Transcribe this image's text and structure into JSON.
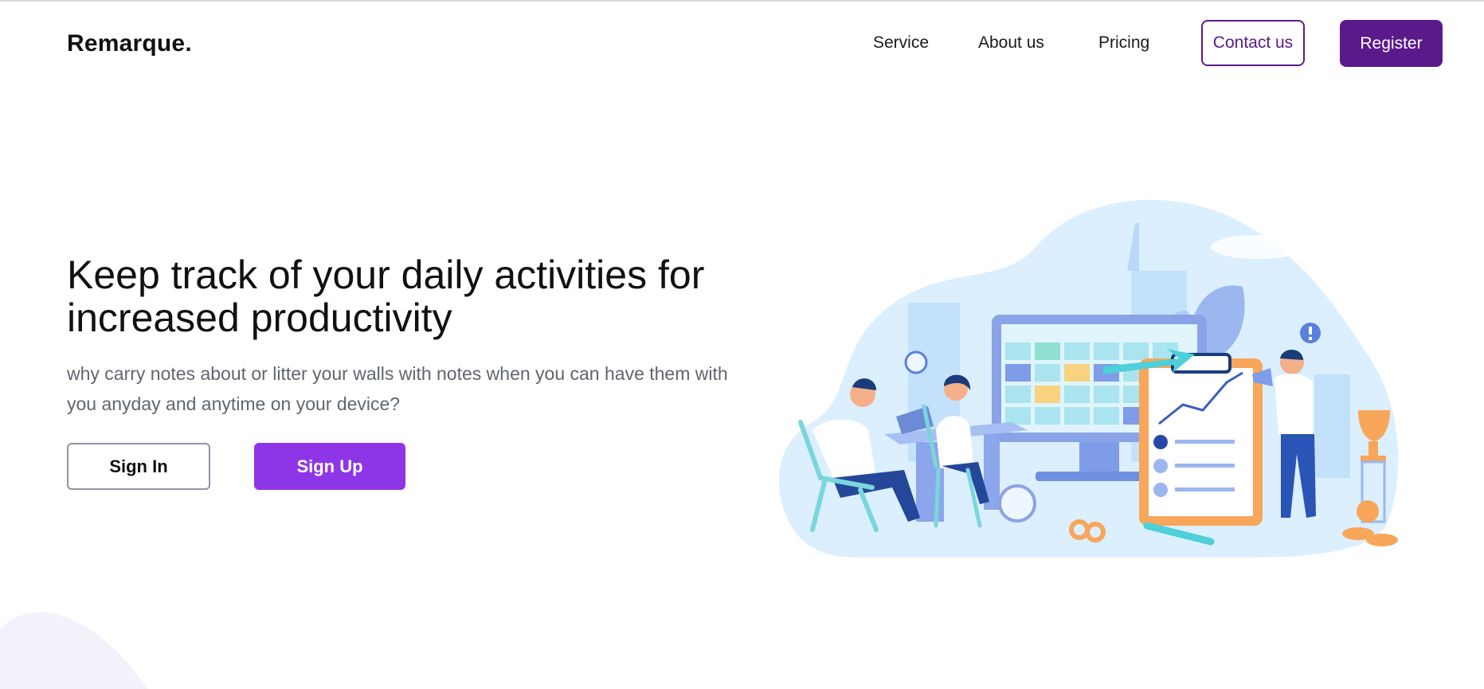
{
  "header": {
    "logo": "Remarque.",
    "nav": [
      "Service",
      "About us",
      "Pricing"
    ],
    "contact_label": "Contact us",
    "register_label": "Register"
  },
  "hero": {
    "title": "Keep track of your daily activities for increased productivity",
    "subtitle": "why carry notes about or litter your walls with notes when you can have them with you anyday and anytime on your device?",
    "signin_label": "Sign In",
    "signup_label": "Sign Up"
  },
  "colors": {
    "brand": "#5b1a8b",
    "signup": "#8e35e8",
    "subtitle_text": "#5f6670",
    "illustration_blob": "#dcefff"
  },
  "icons": {
    "illustration": "team-productivity-illustration",
    "decor": "corner-blob"
  }
}
